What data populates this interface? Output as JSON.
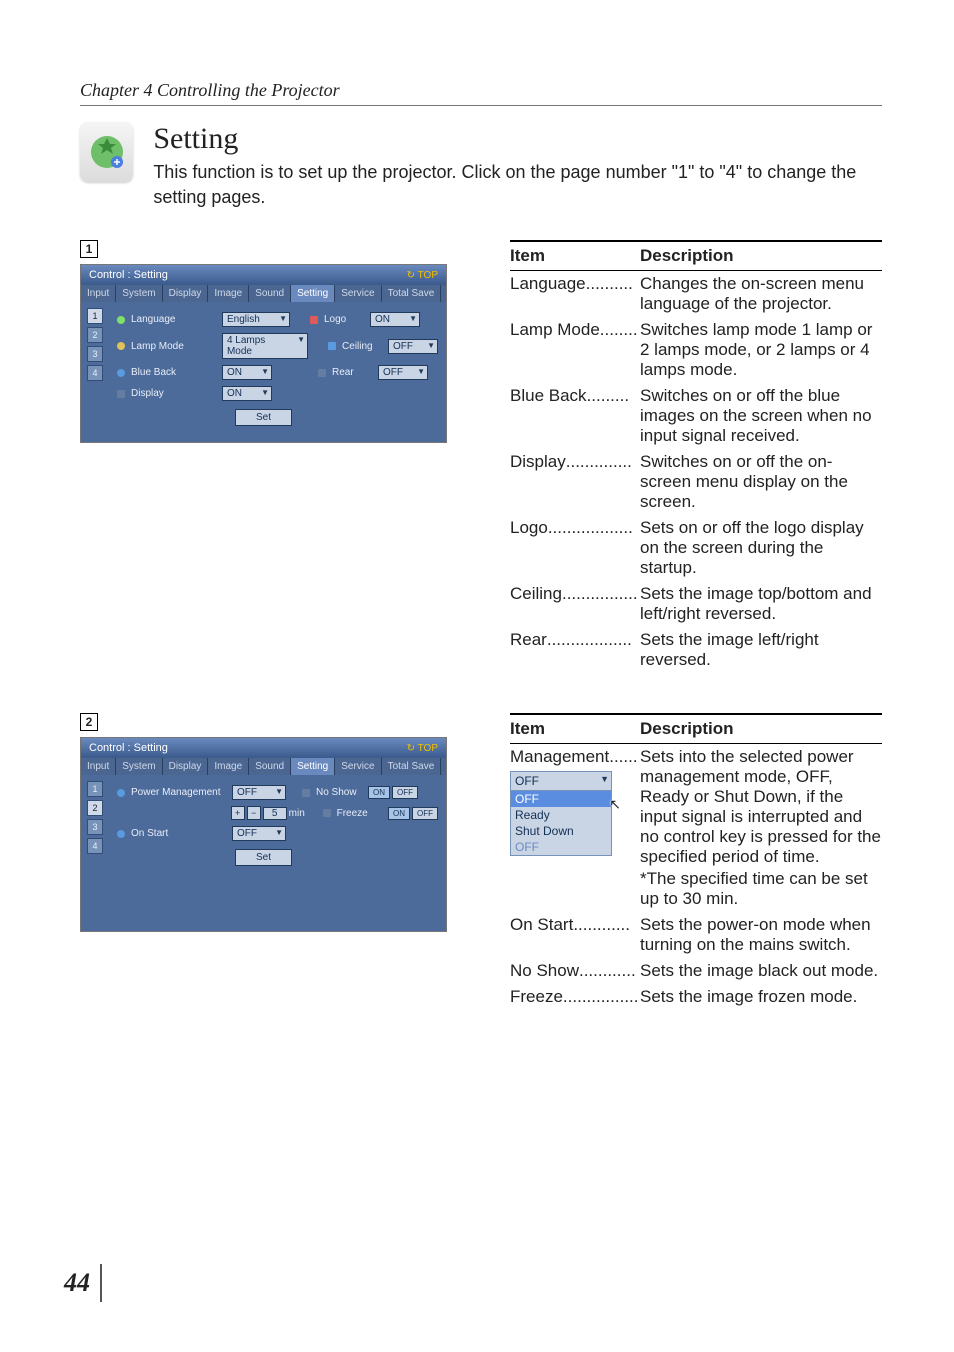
{
  "chapter": "Chapter 4 Controlling the Projector",
  "heading": "Setting",
  "intro": "This function is to set up the projector. Click on the page number \"1\" to \"4\"  to change the setting pages.",
  "page_number": "44",
  "badges": {
    "one": "1",
    "two": "2"
  },
  "screenshot1": {
    "title": "Control : Setting",
    "top": "TOP",
    "tabs": [
      "Input",
      "System",
      "Display",
      "Image",
      "Sound",
      "Setting",
      "Service",
      "Total Save"
    ],
    "pager": [
      "1",
      "2",
      "3",
      "4"
    ],
    "rows": {
      "language": {
        "label": "Language",
        "value": "English"
      },
      "lamp": {
        "label": "Lamp Mode",
        "value": "4 Lamps Mode"
      },
      "blueback": {
        "label": "Blue Back",
        "value": "ON"
      },
      "display": {
        "label": "Display",
        "value": "ON"
      },
      "logo": {
        "label": "Logo",
        "value": "ON"
      },
      "ceiling": {
        "label": "Ceiling",
        "value": "OFF"
      },
      "rear": {
        "label": "Rear",
        "value": "OFF"
      }
    },
    "set": "Set"
  },
  "screenshot2": {
    "title": "Control : Setting",
    "top": "TOP",
    "tabs": [
      "Input",
      "System",
      "Display",
      "Image",
      "Sound",
      "Setting",
      "Service",
      "Total Save"
    ],
    "pager": [
      "1",
      "2",
      "3",
      "4"
    ],
    "rows": {
      "pm": {
        "label": "Power Management",
        "value": "OFF"
      },
      "pm_time": {
        "value": "5",
        "unit": "min"
      },
      "onstart": {
        "label": "On Start",
        "value": "OFF"
      },
      "noshow": {
        "label": "No Show",
        "on": "ON",
        "off": "OFF"
      },
      "freeze": {
        "label": "Freeze",
        "on": "ON",
        "off": "OFF"
      }
    },
    "set": "Set"
  },
  "table1": {
    "head": {
      "item": "Item",
      "desc": "Description"
    },
    "rows": [
      {
        "item": "Language",
        "dots": " ..........",
        "desc": "Changes the on-screen menu language of the projector."
      },
      {
        "item": "Lamp Mode",
        "dots": "........",
        "desc": "Switches lamp mode 1 lamp or 2 lamps mode, or 2 lamps or 4 lamps mode."
      },
      {
        "item": "Blue Back",
        "dots": " .........",
        "desc": "Switches on or off the blue images on the screen when no input signal received."
      },
      {
        "item": "Display",
        "dots": " ..............",
        "desc": "Switches on or off the on-screen menu display on the screen."
      },
      {
        "item": "Logo",
        "dots": " ..................",
        "desc": "Sets on or off the logo display on the screen during the startup."
      },
      {
        "item": "Ceiling",
        "dots": "................",
        "desc": "Sets the image top/bottom and left/right reversed."
      },
      {
        "item": "Rear",
        "dots": " ..................",
        "desc": "Sets the image left/right reversed."
      }
    ]
  },
  "table2": {
    "head": {
      "item": "Item",
      "desc": "Description"
    },
    "rows": [
      {
        "item": "Management",
        "dots": "......",
        "desc": "Sets into the selected power management mode, OFF, Ready or Shut Down, if the input signal is interrupted and no control key is pressed for the specified period of time.",
        "extra": "*The specified time can be set up to 30 min."
      },
      {
        "item": "On Start",
        "dots": " ............",
        "desc": "Sets the power-on mode when turning on the mains switch."
      },
      {
        "item": "No Show",
        "dots": " ............",
        "desc": "Sets the image black out mode."
      },
      {
        "item": "Freeze",
        "dots": "................",
        "desc": "Sets the image frozen mode."
      }
    ],
    "dropdown": {
      "selected": "OFF",
      "opts": [
        "OFF",
        "Ready",
        "Shut Down",
        "OFF"
      ]
    }
  }
}
